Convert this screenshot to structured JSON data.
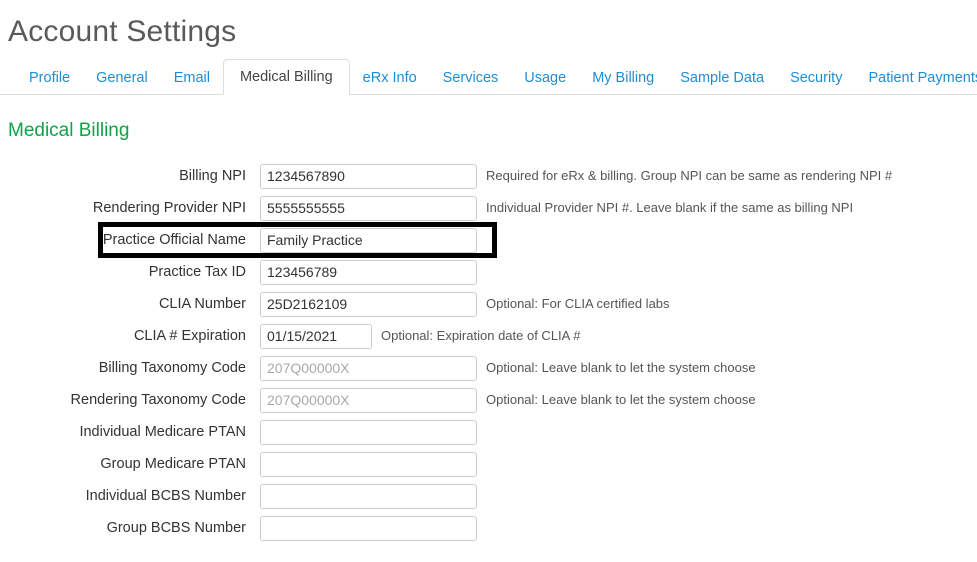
{
  "header": {
    "title": "Account Settings"
  },
  "tabs": {
    "items": [
      {
        "label": "Profile",
        "active": false
      },
      {
        "label": "General",
        "active": false
      },
      {
        "label": "Email",
        "active": false
      },
      {
        "label": "Medical Billing",
        "active": true
      },
      {
        "label": "eRx Info",
        "active": false
      },
      {
        "label": "Services",
        "active": false
      },
      {
        "label": "Usage",
        "active": false
      },
      {
        "label": "My Billing",
        "active": false
      },
      {
        "label": "Sample Data",
        "active": false
      },
      {
        "label": "Security",
        "active": false
      },
      {
        "label": "Patient Payments",
        "active": false
      }
    ]
  },
  "section": {
    "heading": "Medical Billing"
  },
  "form": {
    "rows": [
      {
        "label": "Billing NPI",
        "value": "1234567890",
        "placeholder": "",
        "hint": "Required for eRx & billing. Group NPI can be same as rendering NPI #",
        "narrow": false,
        "highlighted": false
      },
      {
        "label": "Rendering Provider NPI",
        "value": "5555555555",
        "placeholder": "",
        "hint": "Individual Provider NPI #. Leave blank if the same as billing NPI",
        "narrow": false,
        "highlighted": false
      },
      {
        "label": "Practice Official Name",
        "value": "Family Practice",
        "placeholder": "",
        "hint": "",
        "narrow": false,
        "highlighted": true
      },
      {
        "label": "Practice Tax ID",
        "value": "123456789",
        "placeholder": "",
        "hint": "",
        "narrow": false,
        "highlighted": false
      },
      {
        "label": "CLIA Number",
        "value": "25D2162109",
        "placeholder": "",
        "hint": "Optional: For CLIA certified labs",
        "narrow": false,
        "highlighted": false
      },
      {
        "label": "CLIA # Expiration",
        "value": "01/15/2021",
        "placeholder": "",
        "hint": "Optional: Expiration date of CLIA #",
        "narrow": true,
        "highlighted": false
      },
      {
        "label": "Billing Taxonomy Code",
        "value": "",
        "placeholder": "207Q00000X",
        "hint": "Optional: Leave blank to let the system choose",
        "narrow": false,
        "highlighted": false
      },
      {
        "label": "Rendering Taxonomy Code",
        "value": "",
        "placeholder": "207Q00000X",
        "hint": "Optional: Leave blank to let the system choose",
        "narrow": false,
        "highlighted": false
      },
      {
        "label": "Individual Medicare PTAN",
        "value": "",
        "placeholder": "",
        "hint": "",
        "narrow": false,
        "highlighted": false
      },
      {
        "label": "Group Medicare PTAN",
        "value": "",
        "placeholder": "",
        "hint": "",
        "narrow": false,
        "highlighted": false
      },
      {
        "label": "Individual BCBS Number",
        "value": "",
        "placeholder": "",
        "hint": "",
        "narrow": false,
        "highlighted": false
      },
      {
        "label": "Group BCBS Number",
        "value": "",
        "placeholder": "",
        "hint": "",
        "narrow": false,
        "highlighted": false
      }
    ]
  },
  "colors": {
    "link": "#1f8dd6",
    "heading_green": "#13a14a",
    "title_gray": "#5a5a5a",
    "highlight_outline": "#000000",
    "field_border": "#cccccc",
    "placeholder": "#a9a9a9"
  }
}
